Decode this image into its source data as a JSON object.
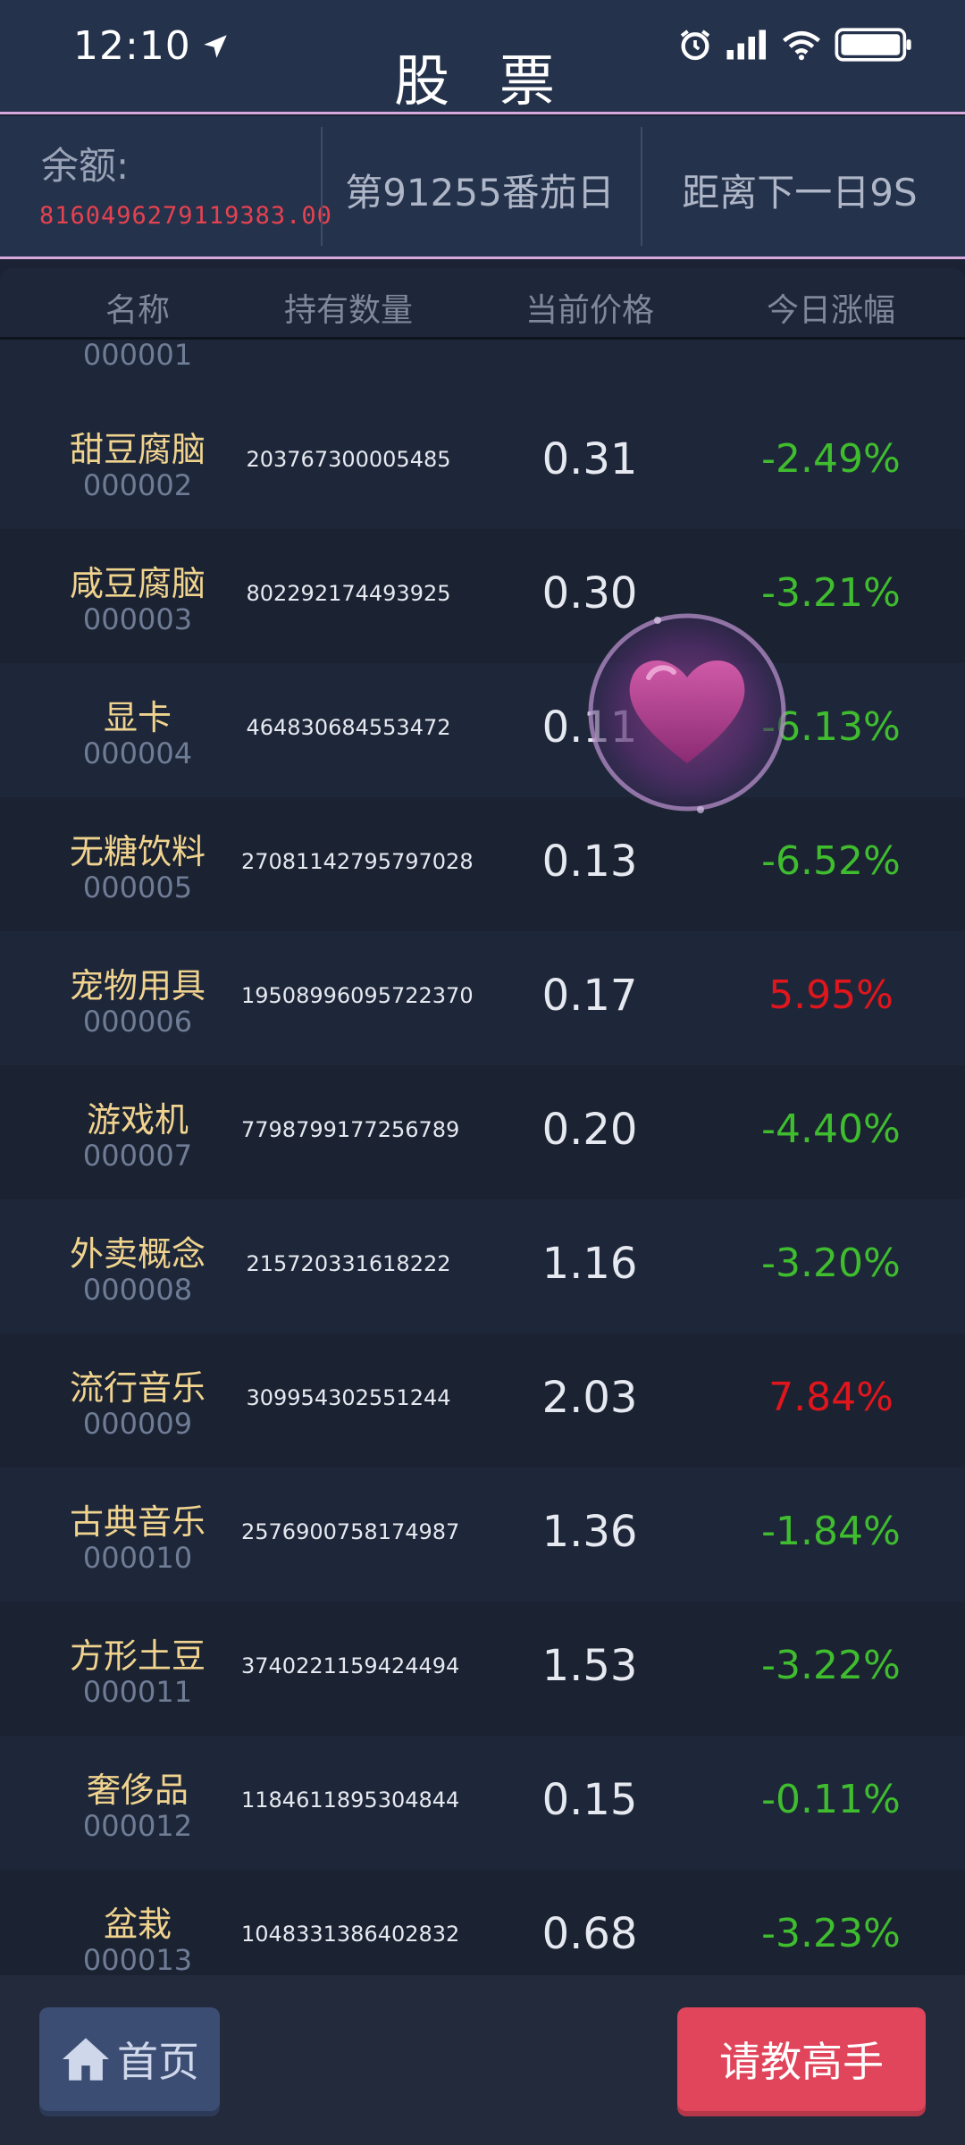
{
  "status_bar": {
    "time": "12:10"
  },
  "header": {
    "title": "股 票"
  },
  "info": {
    "balance_label": "余额:",
    "balance_value": "8160496279119383.00",
    "day_text": "第91255番茄日",
    "next_text": "距离下一日9S"
  },
  "table": {
    "columns": [
      "名称",
      "持有数量",
      "当前价格",
      "今日涨幅"
    ],
    "partial_code": "000001",
    "rows": [
      {
        "name": "甜豆腐脑",
        "code": "000002",
        "qty": "203767300005485",
        "price": "0.31",
        "change": "-2.49%",
        "dir": "down"
      },
      {
        "name": "咸豆腐脑",
        "code": "000003",
        "qty": "802292174493925",
        "price": "0.30",
        "change": "-3.21%",
        "dir": "down"
      },
      {
        "name": "显卡",
        "code": "000004",
        "qty": "464830684553472",
        "price": "0.11",
        "change": "-6.13%",
        "dir": "down"
      },
      {
        "name": "无糖饮料",
        "code": "000005",
        "qty": "2708114279579702​8",
        "price": "0.13",
        "change": "-6.52%",
        "dir": "down"
      },
      {
        "name": "宠物用具",
        "code": "000006",
        "qty": "1950899609572237​0",
        "price": "0.17",
        "change": "5.95%",
        "dir": "up"
      },
      {
        "name": "游戏机",
        "code": "000007",
        "qty": "7798799177256789",
        "price": "0.20",
        "change": "-4.40%",
        "dir": "down"
      },
      {
        "name": "外卖概念",
        "code": "000008",
        "qty": "215720331618222",
        "price": "1.16",
        "change": "-3.20%",
        "dir": "down"
      },
      {
        "name": "流行音乐",
        "code": "000009",
        "qty": "309954302551244",
        "price": "2.03",
        "change": "7.84%",
        "dir": "up"
      },
      {
        "name": "古典音乐",
        "code": "000010",
        "qty": "2576900758174987",
        "price": "1.36",
        "change": "-1.84%",
        "dir": "down"
      },
      {
        "name": "方形土豆",
        "code": "000011",
        "qty": "3740221159424494",
        "price": "1.53",
        "change": "-3.22%",
        "dir": "down"
      },
      {
        "name": "奢侈品",
        "code": "000012",
        "qty": "1184611895304844",
        "price": "0.15",
        "change": "-0.11%",
        "dir": "down"
      },
      {
        "name": "盆栽",
        "code": "000013",
        "qty": "1048331386402832",
        "price": "0.68",
        "change": "-3.23%",
        "dir": "down"
      }
    ]
  },
  "bottom": {
    "home_label": "首页",
    "ask_label": "请教高手"
  },
  "icons": {
    "location": "navigation-arrow-icon",
    "alarm": "alarm-icon",
    "signal": "signal-icon",
    "wifi": "wifi-icon",
    "battery": "battery-icon",
    "home": "home-icon",
    "heart": "heart-icon"
  },
  "colors": {
    "down": "#3fbd2e",
    "up": "#e0161d",
    "name": "#f0d38e",
    "ask_button": "#e0455b",
    "home_button": "#3c4d73"
  }
}
